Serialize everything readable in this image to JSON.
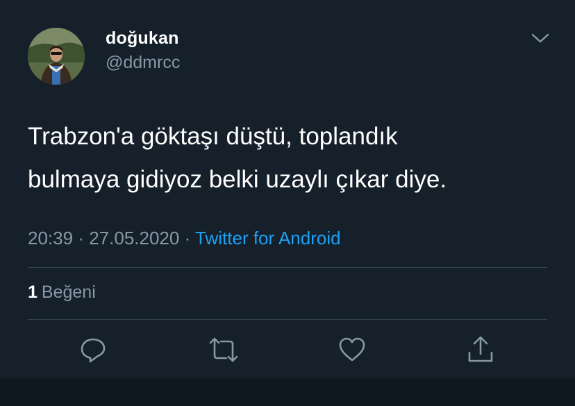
{
  "user": {
    "display_name": "doğukan",
    "handle": "@ddmrcc",
    "avatar_icon": "profile-photo"
  },
  "tweet": {
    "text_lines": [
      "Trabzon'a göktaşı düştü, toplandık",
      "bulmaya gidiyoz belki uzaylı çıkar diye."
    ],
    "time": "20:39",
    "separator": "·",
    "date": "27.05.2020",
    "source": "Twitter for Android"
  },
  "stats": {
    "like_count": "1",
    "like_label": "Beğeni"
  },
  "actions": [
    {
      "icon": "reply-icon"
    },
    {
      "icon": "retweet-icon"
    },
    {
      "icon": "like-icon"
    },
    {
      "icon": "share-icon"
    }
  ],
  "colors": {
    "background": "#15202b",
    "secondary_text": "#8899a6",
    "accent": "#1da1f2",
    "divider": "#38444d"
  }
}
